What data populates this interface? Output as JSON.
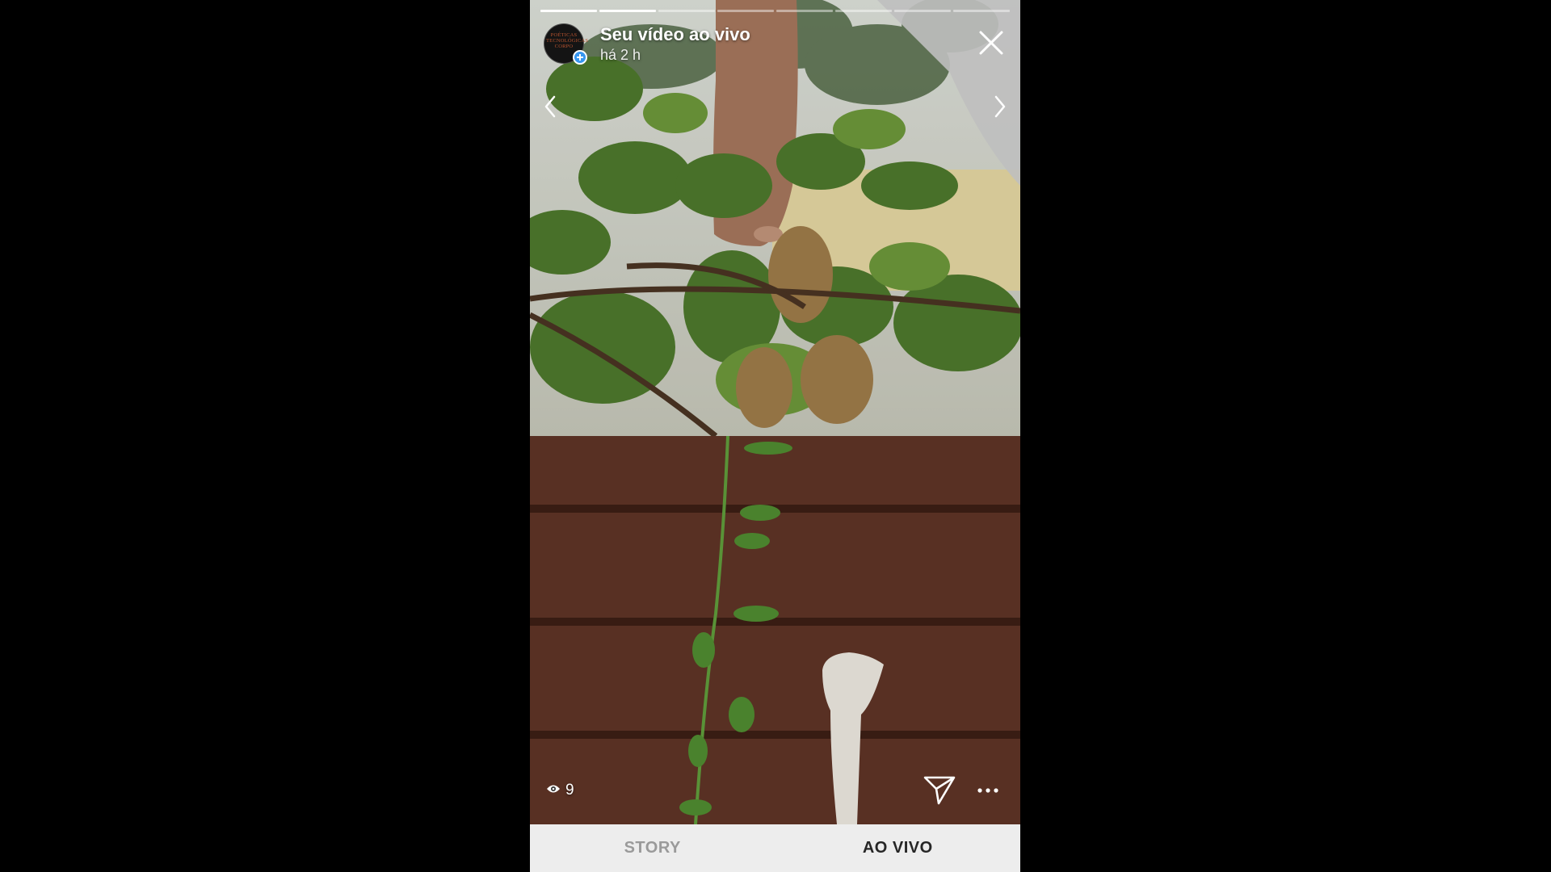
{
  "story": {
    "title": "Seu vídeo ao vivo",
    "time": "há 2 h",
    "avatar_lines": [
      "POÉTICAS",
      "TECNOLÓGICAS",
      "CORPO"
    ],
    "segments_total": 8,
    "segments_done": 2
  },
  "footer": {
    "viewer_count": "9"
  },
  "tabs": {
    "story_label": "STORY",
    "live_label": "AO VIVO",
    "active": "AO VIVO"
  },
  "icons": {
    "close": "close-icon",
    "prev": "chevron-left-icon",
    "next": "chevron-right-icon",
    "viewers": "eye-icon",
    "send": "send-icon",
    "more": "more-icon",
    "add": "plus-icon"
  },
  "colors": {
    "background": "#000000",
    "tabbar": "#ededed",
    "tab_active": "#262626",
    "tab_inactive": "#9a9a9a",
    "add_badge": "#3897f0"
  }
}
